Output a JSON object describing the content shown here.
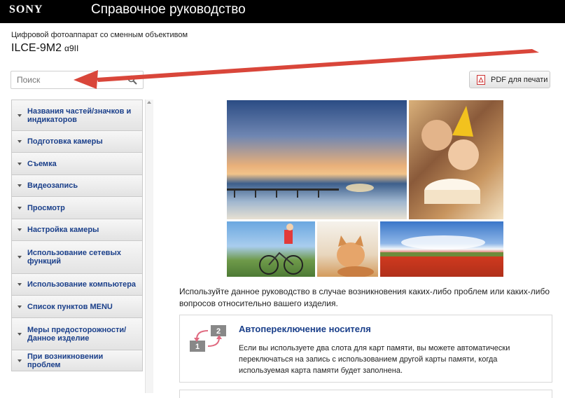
{
  "header": {
    "logo": "SONY",
    "title": "Справочное руководство"
  },
  "product": {
    "subtitle": "Цифровой фотоаппарат со сменным объективом",
    "model": "ILCE-9M2",
    "model_alt": "α9II"
  },
  "search": {
    "placeholder": "Поиск"
  },
  "pdf_button": {
    "label": "PDF для печати"
  },
  "sidebar": {
    "items": [
      {
        "label": "Названия частей/значков и индикаторов",
        "height": 44
      },
      {
        "label": "Подготовка камеры",
        "height": 31
      },
      {
        "label": "Съемка",
        "height": 32
      },
      {
        "label": "Видеозапись",
        "height": 31
      },
      {
        "label": "Просмотр",
        "height": 32
      },
      {
        "label": "Настройка камеры",
        "height": 31
      },
      {
        "label": "Использование сетевых функций",
        "height": 47
      },
      {
        "label": "Использование компьютера",
        "height": 31
      },
      {
        "label": "Список пунктов MENU",
        "height": 32
      },
      {
        "label": "Меры предосторожности/ Данное изделие",
        "height": 46
      },
      {
        "label": "При возникновении проблем",
        "height": 31
      }
    ]
  },
  "intro": {
    "text": "Используйте данное руководство в случае возникновения каких-либо проблем или каких-либо вопросов относительно вашего изделия."
  },
  "feature_card": {
    "title": "Автопереключение носителя",
    "description": "Если вы используете два слота для карт памяти, вы можете автоматически переключаться на запись с использованием другой карты памяти, когда используемая карта памяти будет заполнена.",
    "icon_labels": [
      "1",
      "2"
    ]
  },
  "colors": {
    "topbar": "#000000",
    "nav_text": "#1a3f8a",
    "arrow": "#d9463a"
  }
}
